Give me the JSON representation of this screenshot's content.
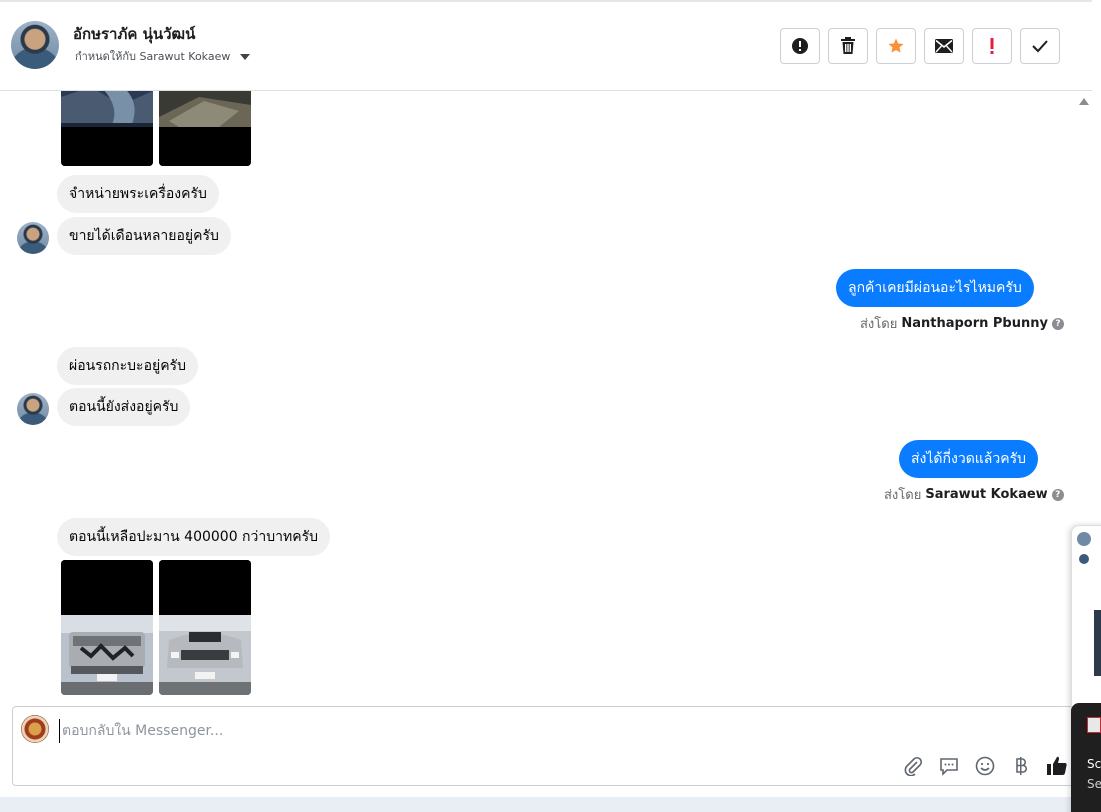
{
  "header": {
    "contact_name": "อักษราภัค นุ่นวัฒน์",
    "assigned_label": "กำหนดให้กับ Sarawut Kokaew",
    "toolbar": [
      {
        "name": "spam-alert",
        "icon": "alert-circle-icon"
      },
      {
        "name": "delete",
        "icon": "trash-icon"
      },
      {
        "name": "star",
        "icon": "star-icon",
        "color": "#f7923b"
      },
      {
        "name": "mark-unread",
        "icon": "envelope-icon"
      },
      {
        "name": "follow-up",
        "icon": "exclamation-icon",
        "color": "#e41e3f"
      },
      {
        "name": "done",
        "icon": "check-icon"
      }
    ]
  },
  "messages": [
    {
      "type": "in",
      "text": "จำหน่ายพระเครื่องครับ"
    },
    {
      "type": "in",
      "text": "ขายได้เดือนหลายอยู่ครับ"
    },
    {
      "type": "out",
      "text": "ลูกค้าเคยมีผ่อนอะไรไหมครับ",
      "sent_by_prefix": "ส่งโดย",
      "sent_by_name": "Nanthaporn Pbunny"
    },
    {
      "type": "in",
      "text": "ผ่อนรถกะบะอยู่ครับ"
    },
    {
      "type": "in",
      "text": "ตอนนี้ยังส่งอยู่ครับ"
    },
    {
      "type": "out",
      "text": "ส่งได้กี่งวดแล้วครับ",
      "sent_by_prefix": "ส่งโดย",
      "sent_by_name": "Sarawut Kokaew"
    },
    {
      "type": "in",
      "text": "ตอนนี้เหลือปะมาน 400000 กว่าบาทครับ"
    }
  ],
  "composer": {
    "placeholder": "ตอบกลับใน Messenger...",
    "tools": [
      "paperclip-icon",
      "speech-bubble-icon",
      "smiley-icon",
      "baht-icon",
      "thumbs-up-icon"
    ]
  },
  "overlay": {
    "line1": "Sc",
    "line2": "Se"
  },
  "colors": {
    "outgoing_bubble": "#0a7cff",
    "incoming_bubble": "#f0f0f0",
    "accent_star": "#f7923b",
    "accent_red": "#e41e3f"
  }
}
